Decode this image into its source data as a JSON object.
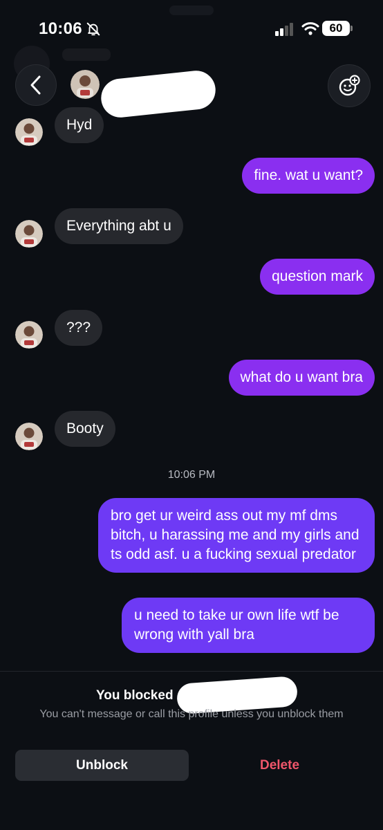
{
  "status_bar": {
    "time": "10:06",
    "battery": "60"
  },
  "messages": [
    {
      "side": "in",
      "text": "Hyd"
    },
    {
      "side": "out",
      "text": "fine. wat u want?"
    },
    {
      "side": "in",
      "text": "Everything abt u"
    },
    {
      "side": "out",
      "text": "question mark"
    },
    {
      "side": "in",
      "text": "???"
    },
    {
      "side": "out",
      "text": "what do u want bra"
    },
    {
      "side": "in",
      "text": "Booty"
    },
    {
      "side": "out",
      "text": "bro get ur weird ass out my mf dms bitch, u harassing me and my girls and ts odd asf. u a fucking sexual predator"
    },
    {
      "side": "out",
      "text": "u need to take ur own life wtf be wrong with yall bra"
    }
  ],
  "timestamp": "10:06 PM",
  "footer": {
    "blocked_title": "You blocked",
    "blocked_subtitle": "You can't message or call this profile unless you unblock them",
    "unblock_label": "Unblock",
    "delete_label": "Delete"
  },
  "colors": {
    "background": "#0c0f14",
    "incoming_bubble": "#26282d",
    "outgoing_bubble": "#8a2ff0",
    "outgoing_bubble_late": "#6e3af5",
    "delete_text": "#f0566b"
  },
  "icons": {
    "mute": "bell-off-icon",
    "signal": "cellular-signal-icon",
    "wifi": "wifi-icon",
    "back": "chevron-left-icon",
    "effects": "sticker-add-icon"
  }
}
